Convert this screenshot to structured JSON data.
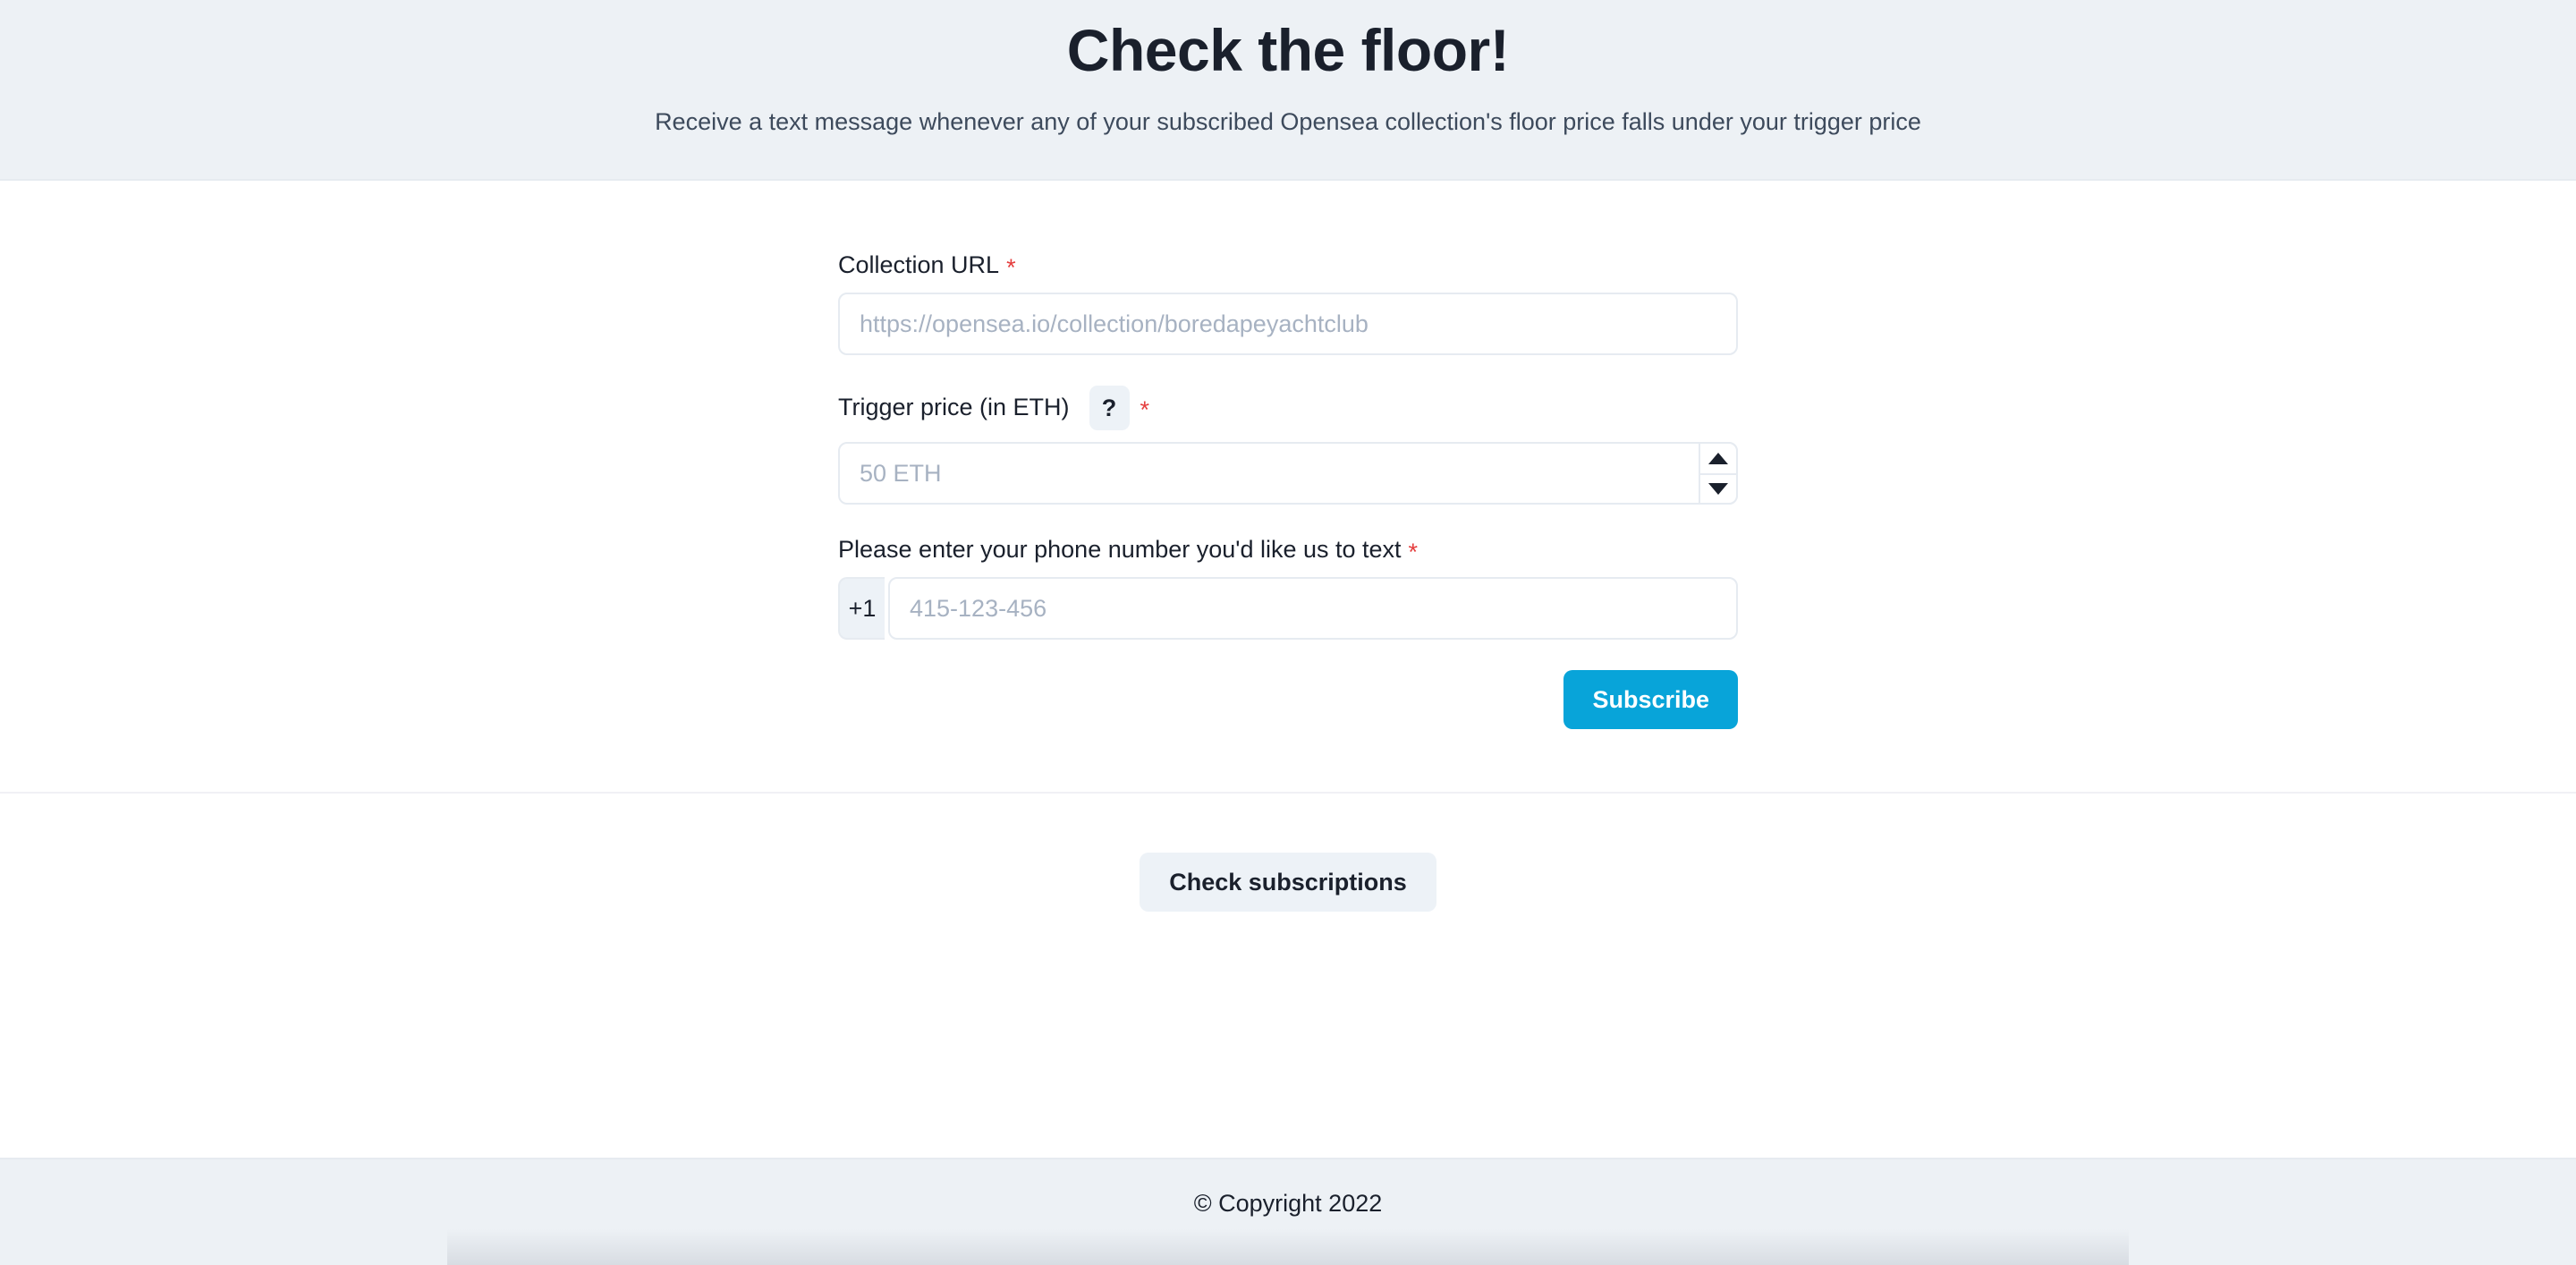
{
  "header": {
    "title": "Check the floor!",
    "subtitle": "Receive a text message whenever any of your subscribed Opensea collection's floor price falls under your trigger price",
    "background_color": "#edf1f5"
  },
  "form": {
    "collection_url": {
      "label": "Collection URL",
      "required_marker": "*",
      "placeholder": "https://opensea.io/collection/boredapeyachtclub",
      "value": ""
    },
    "trigger_price": {
      "label": "Trigger price (in ETH)",
      "help_icon": "?",
      "required_marker": "*",
      "placeholder": "50 ETH",
      "value": "",
      "stepper_up": "▲",
      "stepper_down": "▼"
    },
    "phone": {
      "label": "Please enter your phone number you'd like us to text",
      "required_marker": "*",
      "country_code": "+1",
      "placeholder": "415-123-456",
      "value": ""
    },
    "submit_label": "Subscribe",
    "submit_color": "#08a4d9"
  },
  "secondary": {
    "check_subscriptions_label": "Check subscriptions",
    "button_color": "#edf2f7"
  },
  "footer": {
    "copyright": "© Copyright 2022"
  }
}
